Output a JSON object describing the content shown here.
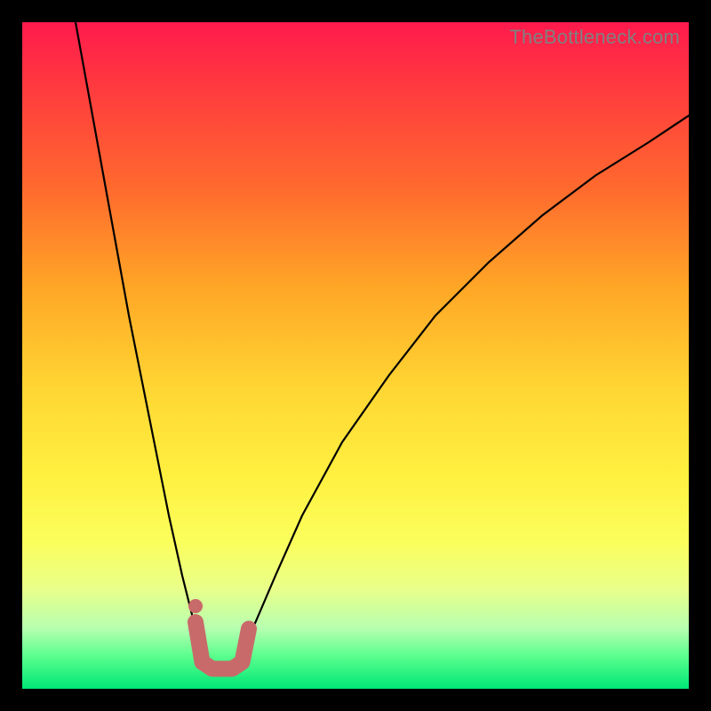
{
  "watermark": "TheBottleneck.com",
  "chart_data": {
    "type": "line",
    "title": "",
    "xlabel": "",
    "ylabel": "",
    "xlim": [
      0,
      100
    ],
    "ylim": [
      0,
      100
    ],
    "series": [
      {
        "name": "bottleneck-curve",
        "x": [
          8,
          10,
          12,
          14,
          16,
          18,
          20,
          22,
          24,
          26,
          27,
          28,
          29,
          30,
          31,
          32,
          33,
          35,
          38,
          42,
          48,
          55,
          62,
          70,
          78,
          86,
          94,
          100
        ],
        "y": [
          100,
          89,
          78,
          67,
          56,
          46,
          36,
          26,
          17,
          9,
          6,
          4,
          3,
          3,
          3,
          4,
          6,
          10,
          17,
          26,
          37,
          47,
          56,
          64,
          71,
          77,
          82,
          86
        ]
      }
    ],
    "annotations": {
      "optimal_zone": {
        "type": "marker-band",
        "color": "#c96a6a",
        "points": [
          {
            "x": 26.0,
            "y": 10.0
          },
          {
            "x": 27.0,
            "y": 4.0
          },
          {
            "x": 28.5,
            "y": 3.0
          },
          {
            "x": 30.0,
            "y": 3.0
          },
          {
            "x": 31.5,
            "y": 3.0
          },
          {
            "x": 33.0,
            "y": 4.0
          },
          {
            "x": 34.0,
            "y": 9.0
          }
        ]
      }
    }
  }
}
